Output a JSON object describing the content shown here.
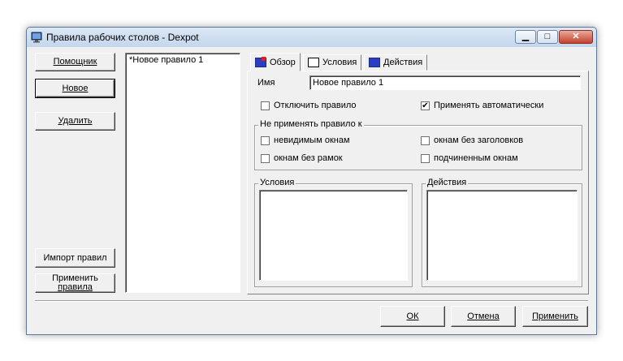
{
  "window": {
    "title": "Правила рабочих столов - Dexpot"
  },
  "left_buttons": {
    "assistant": "Помощник",
    "new": "Новое",
    "delete": "Удалить",
    "import": "Импорт правил",
    "apply_rules_1": "Применить",
    "apply_rules_2": "правила"
  },
  "rules_list": [
    "*Новое правило 1"
  ],
  "tabs": [
    {
      "label": "Обзор"
    },
    {
      "label": "Условия"
    },
    {
      "label": "Действия"
    }
  ],
  "overview": {
    "name_label": "Имя",
    "name_value": "Новое правило 1",
    "disable_rule": {
      "label": "Отключить правило",
      "checked": false
    },
    "apply_auto": {
      "label": "Применять автоматически",
      "checked": true
    },
    "exclude_group_label": "Не применять правило к",
    "invisible": {
      "label": "невидимым окнам",
      "checked": false
    },
    "no_title": {
      "label": "окнам без заголовков",
      "checked": false
    },
    "no_border": {
      "label": "окнам без рамок",
      "checked": false
    },
    "child": {
      "label": "подчиненным окнам",
      "checked": false
    },
    "conditions_label": "Условия",
    "actions_label": "Действия"
  },
  "bottom_buttons": {
    "ok": "ОК",
    "cancel": "Отмена",
    "apply": "Применить"
  }
}
